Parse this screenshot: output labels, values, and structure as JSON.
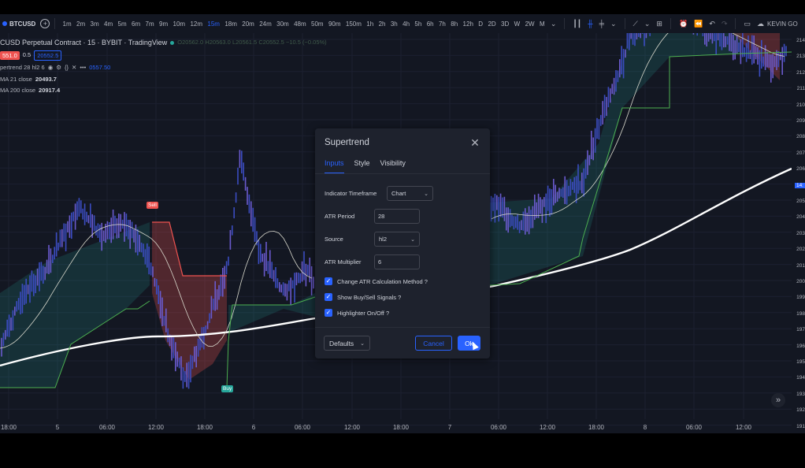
{
  "toolbar": {
    "symbol": "BTCUSD",
    "timeframes": [
      "1m",
      "2m",
      "3m",
      "4m",
      "5m",
      "6m",
      "7m",
      "9m",
      "10m",
      "12m",
      "15m",
      "18m",
      "20m",
      "24m",
      "30m",
      "48m",
      "50m",
      "90m",
      "150m",
      "1h",
      "2h",
      "3h",
      "4h",
      "5h",
      "6h",
      "7h",
      "8h",
      "12h",
      "D",
      "2D",
      "3D",
      "W",
      "2W",
      "M"
    ],
    "active_timeframe": "15m",
    "user": "KEVIN GO"
  },
  "legend": {
    "title": "CUSD Perpetual Contract · 15 · BYBIT · TradingView",
    "ohlc": {
      "o": "O20562.0",
      "h": "H20563.0",
      "l": "L20561.5",
      "c": "C20552.5",
      "chg": "−10.5 (−0.05%)"
    },
    "bid": "551.0",
    "spread": "0.5",
    "ask": "20552.5",
    "indicators": [
      {
        "name": "pertrend 28 hl2 6",
        "value": "0557.50"
      },
      {
        "name": "MA 21 close",
        "value": "20493.7"
      },
      {
        "name": "MA 200 close",
        "value": "20917.4"
      }
    ]
  },
  "price_axis": [
    "214",
    "213",
    "212",
    "211",
    "210",
    "209",
    "208",
    "207",
    "206",
    "14:",
    "205",
    "204",
    "203",
    "202",
    "201",
    "200",
    "199",
    "198",
    "197",
    "196",
    "195",
    "194",
    "193",
    "192",
    "191"
  ],
  "time_axis": [
    {
      "label": "18:00"
    },
    {
      "label": "5"
    },
    {
      "label": "06:00"
    },
    {
      "label": "12:00"
    },
    {
      "label": "18:00"
    },
    {
      "label": "6"
    },
    {
      "label": "06:00"
    },
    {
      "label": "12:00"
    },
    {
      "label": "18:00"
    },
    {
      "label": "7"
    },
    {
      "label": "06:00"
    },
    {
      "label": "12:00"
    },
    {
      "label": "18:00"
    },
    {
      "label": "8"
    },
    {
      "label": "06:00"
    },
    {
      "label": "12:00"
    }
  ],
  "signals": {
    "sell": "Sell",
    "buy": "Buy"
  },
  "dialog": {
    "title": "Supertrend",
    "tabs": [
      "Inputs",
      "Style",
      "Visibility"
    ],
    "active_tab": "Inputs",
    "timeframe_label": "Indicator Timeframe",
    "timeframe_value": "Chart",
    "atr_period_label": "ATR Period",
    "atr_period_value": "28",
    "source_label": "Source",
    "source_value": "hl2",
    "atr_mult_label": "ATR Multiplier",
    "atr_mult_value": "6",
    "checkboxes": [
      {
        "label": "Change ATR Calculation Method ?",
        "checked": true
      },
      {
        "label": "Show Buy/Sell Signals ?",
        "checked": true
      },
      {
        "label": "Highlighter On/Off ?",
        "checked": true
      }
    ],
    "defaults": "Defaults",
    "cancel": "Cancel",
    "ok": "Ok"
  },
  "colors": {
    "accent": "#2962ff",
    "up": "#26a69a",
    "down": "#ef5350",
    "bg": "#131722"
  }
}
